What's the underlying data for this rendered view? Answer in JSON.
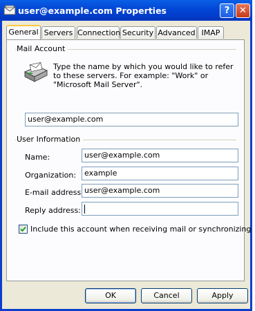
{
  "window": {
    "title": "user@example.com Properties",
    "help_label": "?",
    "close_label": "✕"
  },
  "tabs": [
    {
      "label": "General"
    },
    {
      "label": "Servers"
    },
    {
      "label": "Connection"
    },
    {
      "label": "Security"
    },
    {
      "label": "Advanced"
    },
    {
      "label": "IMAP"
    }
  ],
  "active_tab": "General",
  "mail_account": {
    "group_title": "Mail Account",
    "description": "Type the name by which you would like to refer to these servers.  For example: \"Work\" or \"Microsoft Mail Server\".",
    "account_name": "user@example.com"
  },
  "user_information": {
    "group_title": "User Information",
    "name_label": "Name:",
    "name_value": "user@example.com",
    "organization_label": "Organization:",
    "organization_value": "example",
    "email_label": "E-mail address:",
    "email_value": "user@example.com",
    "reply_label": "Reply address:",
    "reply_value": ""
  },
  "include_account": {
    "checked": true,
    "label": "Include this account when receiving mail or synchronizing"
  },
  "buttons": {
    "ok": "OK",
    "cancel": "Cancel",
    "apply": "Apply"
  },
  "colors": {
    "titlebar": "#0246d6",
    "dialog_face": "#ece9d8",
    "tab_page": "#fcfcfe",
    "active_tab_highlight": "#ffc83c",
    "field_border": "#7f9db9"
  },
  "icons": {
    "title": "envelope-icon",
    "mail_account": "mail-account-icon",
    "checkbox": "checkmark-icon"
  }
}
